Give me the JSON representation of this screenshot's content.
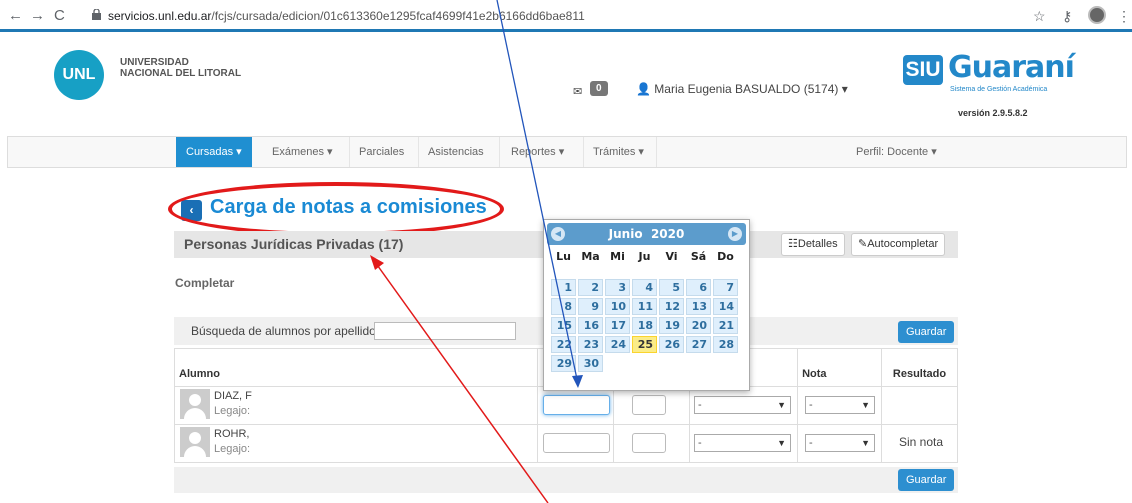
{
  "browser": {
    "url_domain": "servicios.unl.edu.ar",
    "url_path": "/fcjs/cursada/edicion/01c613360e1295fcaf4699f41e2b6166dd6bae811"
  },
  "header": {
    "unl_logo": "UNL",
    "unl_line1": "UNIVERSIDAD",
    "unl_line2": "NACIONAL DEL LITORAL",
    "mail_count": "0",
    "user_name": "Maria Eugenia BASUALDO (5174) ▾",
    "siu": "SIU",
    "guarani": "Guaraní",
    "guarani_sub": "Sistema de Gestión Académica",
    "version": "versión 2.9.5.8.2"
  },
  "nav": {
    "cursadas": "Cursadas ▾",
    "examenes": "Exámenes ▾",
    "parciales": "Parciales",
    "asistencias": "Asistencias",
    "reportes": "Reportes ▾",
    "tramites": "Trámites ▾",
    "perfil": "Perfil: Docente ▾"
  },
  "page": {
    "title": "Carga de notas a comisiones",
    "back_icon": "‹",
    "subtitle": "Personas Jurídicas Privadas (17)",
    "detalles": "Detalles",
    "autocompletar": "Autocompletar",
    "completar": "Completar",
    "search_label": "Búsqueda de alumnos por apellido",
    "guardar": "Guardar"
  },
  "table": {
    "headers": {
      "alumno": "Alumno",
      "nota": "Nota",
      "resultado": "Resultado"
    },
    "rows": [
      {
        "name": "DIAZ, F",
        "legajo": "Legajo:",
        "fecha": "",
        "folio": "",
        "condicion": "-",
        "nota": "-",
        "resultado": ""
      },
      {
        "name": "ROHR,",
        "legajo": "Legajo:",
        "fecha": "",
        "folio": "",
        "condicion": "-",
        "nota": "-",
        "resultado": "Sin nota"
      }
    ]
  },
  "datepicker": {
    "month": "Junio",
    "year": "2020",
    "days_of_week": [
      "Lu",
      "Ma",
      "Mi",
      "Ju",
      "Vi",
      "Sá",
      "Do"
    ],
    "today": "25",
    "days": [
      "1",
      "2",
      "3",
      "4",
      "5",
      "6",
      "7",
      "8",
      "9",
      "10",
      "11",
      "12",
      "13",
      "14",
      "15",
      "16",
      "17",
      "18",
      "19",
      "20",
      "21",
      "22",
      "23",
      "24",
      "25",
      "26",
      "27",
      "28",
      "29",
      "30"
    ]
  },
  "colors": {
    "accent": "#1f8fd1",
    "annotation": "#e21a1a",
    "annotation_arrow": "#2255bb"
  }
}
